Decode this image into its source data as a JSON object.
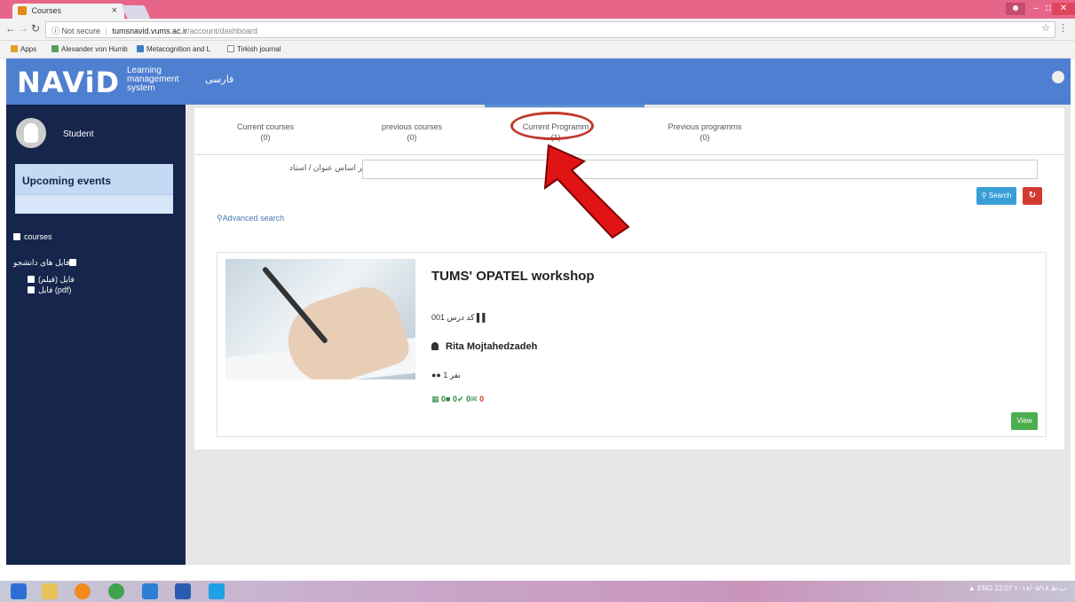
{
  "browser": {
    "tab_title": "Courses",
    "tab_close": "×",
    "url_security": "Not secure",
    "url_host": "tumsnavid.vums.ac.ir",
    "url_path": "/account/dashboard",
    "bookmarks": [
      "Apps",
      "Alexander von Humb",
      "Metacognition and L",
      "Tirkish journal"
    ]
  },
  "header": {
    "logo": "NAViD",
    "logo_sub_1": "Learning",
    "logo_sub_2": "management",
    "logo_sub_3": "system",
    "language": "فارسی"
  },
  "sidebar": {
    "user_name": "Student",
    "events_title": "Upcoming events",
    "links": {
      "courses": "courses",
      "student_files": "فایل های دانشجو",
      "file_video": "(فایل (فیلم",
      "file_pdf": "فایل (pdf)"
    }
  },
  "tabs": [
    {
      "label": "Current courses",
      "count": "(0)"
    },
    {
      "label": "previous courses",
      "count": "(0)"
    },
    {
      "label": "Current Programm",
      "count": "(1)"
    },
    {
      "label": "Previous programms",
      "count": "(0)"
    }
  ],
  "search": {
    "label": "بر اساس عنوان / استاد",
    "value": "",
    "search_button": "Search",
    "reset_icon": "refresh-icon",
    "advanced": "Advanced search"
  },
  "course": {
    "title": "TUMS' OPATEL workshop",
    "code": "کد درس 001",
    "teacher": "Rita Mojtahedzadeh",
    "members": "نفر 1",
    "stats": [
      "0",
      "0",
      "0",
      "0"
    ],
    "view_button": "View"
  },
  "taskbar": {
    "lang": "ENG",
    "time": "12:07 ب.ظ",
    "date": "۲۰۱۸/۰۵/۱۸"
  }
}
